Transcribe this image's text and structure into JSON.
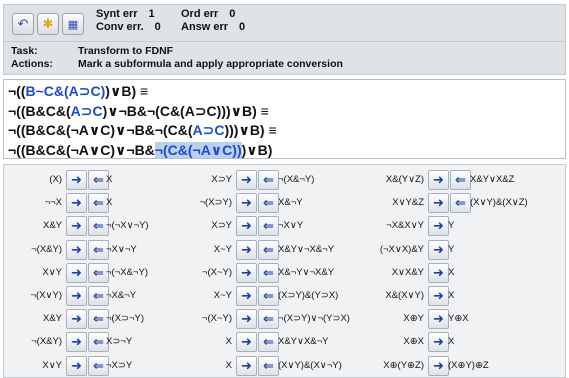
{
  "stats": {
    "synt_err_label": "Synt err",
    "synt_err_value": "1",
    "ord_err_label": "Ord err",
    "ord_err_value": "0",
    "conv_err_label": "Conv err.",
    "conv_err_value": "0",
    "answ_err_label": "Answ err",
    "answ_err_value": "0"
  },
  "task": {
    "task_label": "Task:",
    "task_value": "Transform to FDNF",
    "actions_label": "Actions:",
    "actions_value": "Mark a subformula and apply appropriate conversion"
  },
  "formulas": [
    [
      {
        "t": "¬(("
      },
      {
        "t": "B~C&(A⊃C)",
        "cls": "hl-blue"
      },
      {
        "t": ")∨B) ≡"
      }
    ],
    [
      {
        "t": "¬((B&C&("
      },
      {
        "t": "A⊃C",
        "cls": "hl-blue"
      },
      {
        "t": ")∨¬B&¬(C&(A⊃C)))∨B) ≡"
      }
    ],
    [
      {
        "t": "¬((B&C&(¬A∨C)∨¬B&¬(C&("
      },
      {
        "t": "A⊃C",
        "cls": "hl-blue"
      },
      {
        "t": ")))∨B) ≡"
      }
    ],
    [
      {
        "t": "¬((B&C&(¬A∨C)∨¬B&"
      },
      {
        "t": "¬(C&(¬A∨C))",
        "cls": "hl-blue hl-sel"
      },
      {
        "t": ")∨B)"
      }
    ]
  ],
  "rules": {
    "col1": [
      {
        "lhs": "(X)",
        "rhs": "X"
      },
      {
        "lhs": "¬¬X",
        "rhs": "X"
      },
      {
        "lhs": "X&Y",
        "rhs": "¬(¬X∨¬Y)"
      },
      {
        "lhs": "¬(X&Y)",
        "rhs": "¬X∨¬Y"
      },
      {
        "lhs": "X∨Y",
        "rhs": "¬(¬X&¬Y)"
      },
      {
        "lhs": "¬(X∨Y)",
        "rhs": "¬X&¬Y"
      },
      {
        "lhs": "X&Y",
        "rhs": "¬(X⊃¬Y)"
      },
      {
        "lhs": "¬(X&Y)",
        "rhs": "X⊃¬Y"
      },
      {
        "lhs": "X∨Y",
        "rhs": "¬X⊃Y"
      }
    ],
    "col2": [
      {
        "lhs": "X⊃Y",
        "rhs": "¬(X&¬Y)"
      },
      {
        "lhs": "¬(X⊃Y)",
        "rhs": "X&¬Y"
      },
      {
        "lhs": "X⊃Y",
        "rhs": "¬X∨Y"
      },
      {
        "lhs": "X~Y",
        "rhs": "X&Y∨¬X&¬Y"
      },
      {
        "lhs": "¬(X~Y)",
        "rhs": "X&¬Y∨¬X&Y"
      },
      {
        "lhs": "X~Y",
        "rhs": "(X⊃Y)&(Y⊃X)"
      },
      {
        "lhs": "¬(X~Y)",
        "rhs": "¬(X⊃Y)∨¬(Y⊃X)"
      },
      {
        "lhs": "X",
        "rhs": "X&Y∨X&¬Y"
      },
      {
        "lhs": "X",
        "rhs": "(X∨Y)&(X∨¬Y)"
      }
    ],
    "col3": [
      {
        "lhs": "X&(Y∨Z)",
        "rhs": "X&Y∨X&Z",
        "back": true
      },
      {
        "lhs": "X∨Y&Z",
        "rhs": "(X∨Y)&(X∨Z)",
        "back": true
      },
      {
        "lhs": "¬X&X∨Y",
        "rhs": "Y"
      },
      {
        "lhs": "(¬X∨X)&Y",
        "rhs": "Y"
      },
      {
        "lhs": "X∨X&Y",
        "rhs": "X"
      },
      {
        "lhs": "X&(X∨Y)",
        "rhs": "X"
      },
      {
        "lhs": "X⊕Y",
        "rhs": "Y⊕X"
      },
      {
        "lhs": "X⊕X",
        "rhs": "X"
      },
      {
        "lhs": "X⊕(Y⊕Z)",
        "rhs": "(X⊕Y)⊕Z"
      }
    ]
  },
  "icons": {
    "undo": "undo-icon",
    "hint": "bulb-icon",
    "check": "checker-icon"
  },
  "colors": {
    "accent": "#2149c9",
    "selection": "#b9d0ee"
  }
}
